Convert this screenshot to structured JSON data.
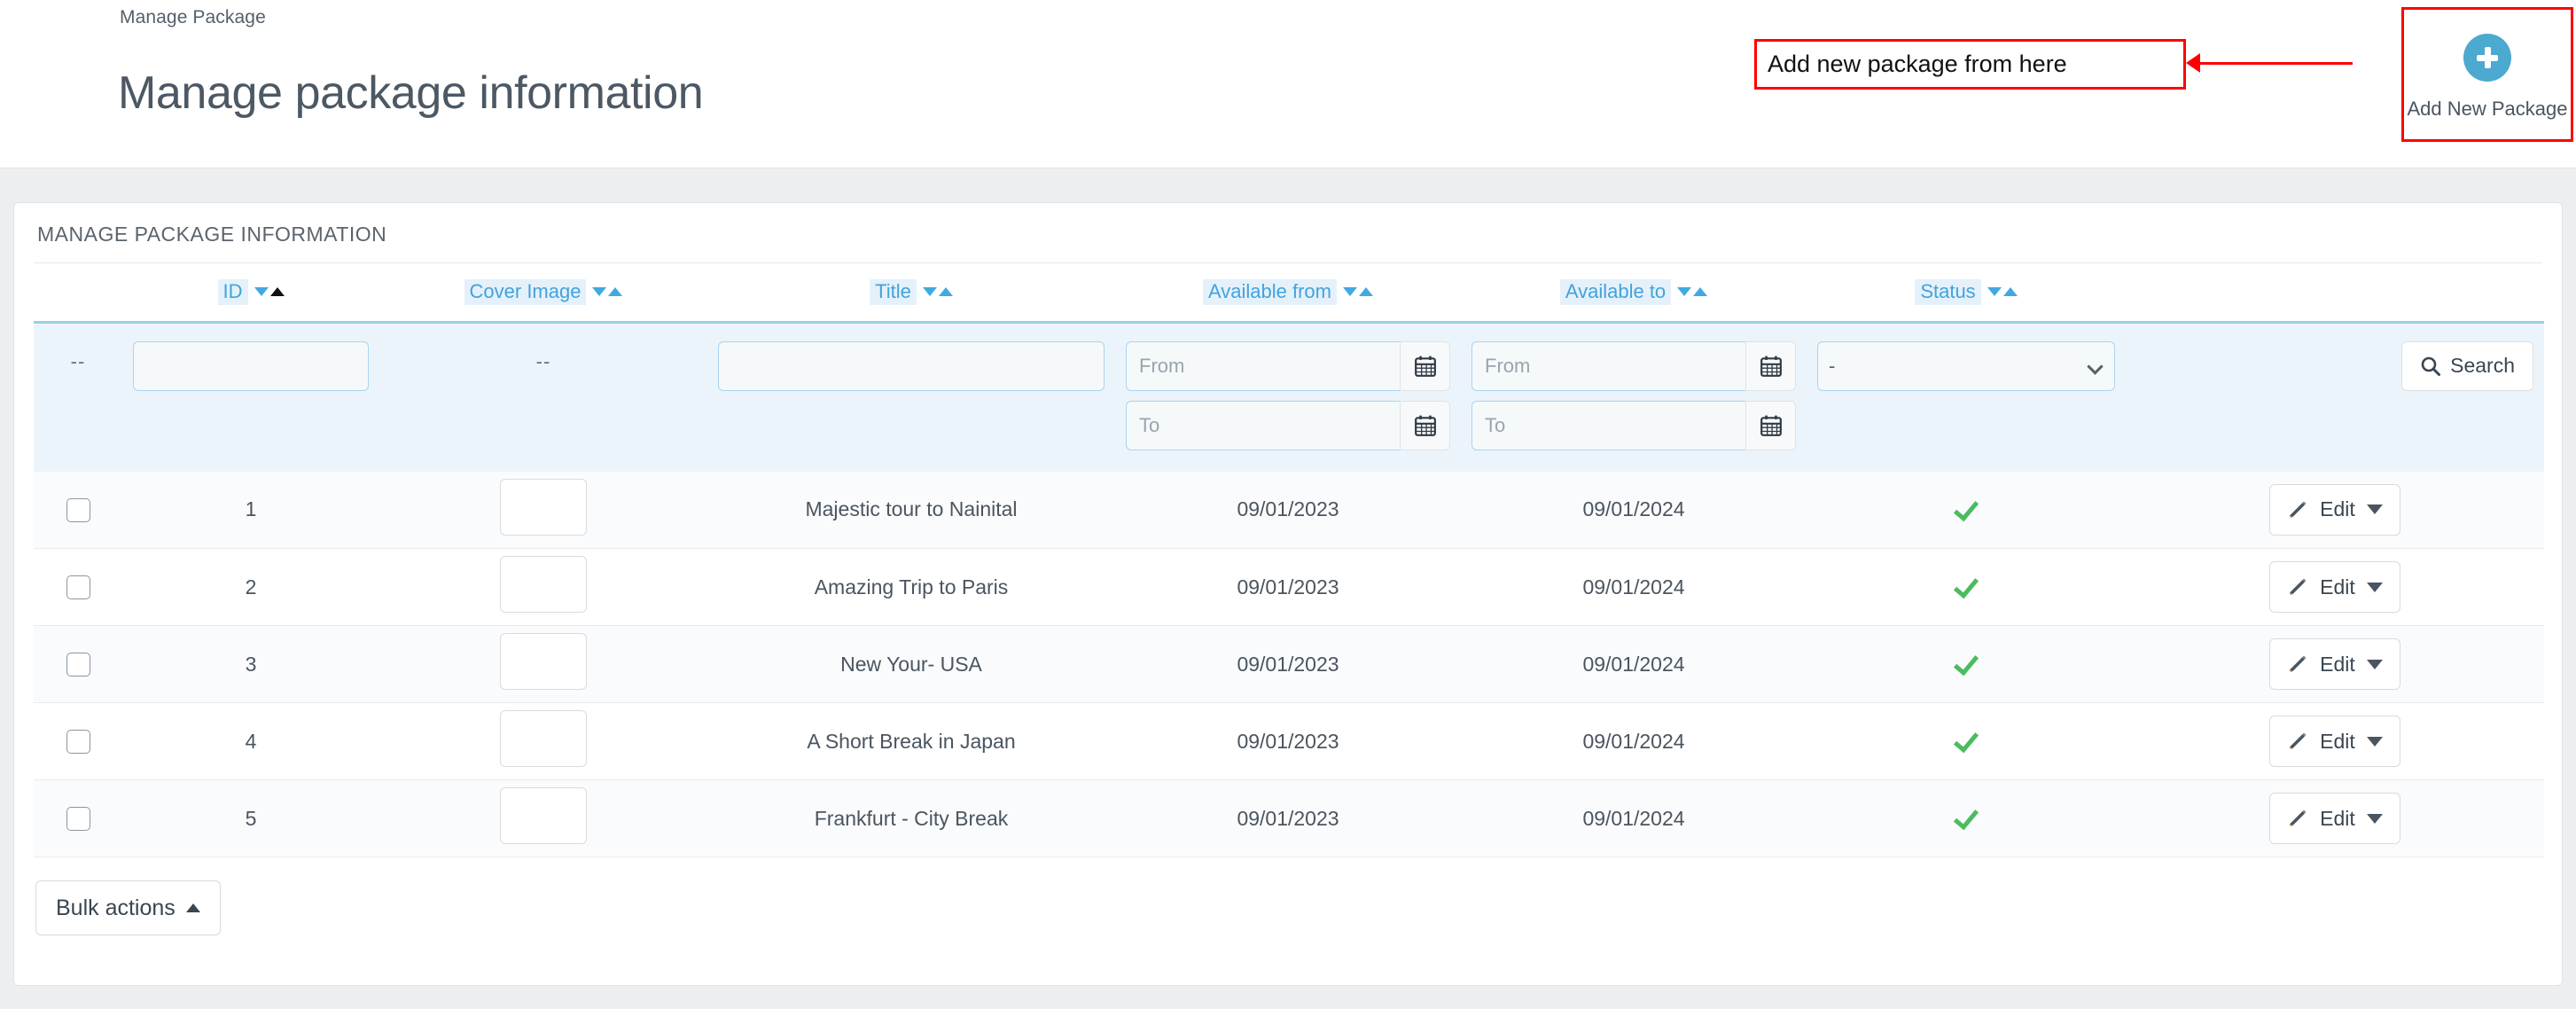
{
  "header": {
    "breadcrumb": "Manage Package",
    "title": "Manage package information",
    "annotation": "Add new package from here",
    "add_button_label": "Add New Package",
    "add_icon": "plus-circle-icon",
    "accent_blue": "#4CA9CF",
    "annotation_color": "#ff0000"
  },
  "card": {
    "title": "MANAGE PACKAGE INFORMATION"
  },
  "table": {
    "columns": [
      {
        "key": "checkbox",
        "label": "",
        "sortable": false
      },
      {
        "key": "id",
        "label": "ID",
        "sortable": true,
        "sort_active": "asc"
      },
      {
        "key": "cover_image",
        "label": "Cover Image",
        "sortable": true,
        "sort_active": "none"
      },
      {
        "key": "title",
        "label": "Title",
        "sortable": true,
        "sort_active": "none"
      },
      {
        "key": "available_from",
        "label": "Available from",
        "sortable": true,
        "sort_active": "none"
      },
      {
        "key": "available_to",
        "label": "Available to",
        "sortable": true,
        "sort_active": "none"
      },
      {
        "key": "status",
        "label": "Status",
        "sortable": true,
        "sort_active": "none"
      },
      {
        "key": "actions",
        "label": "",
        "sortable": false
      }
    ],
    "filters": {
      "checkbox_placeholder": "--",
      "id_value": "",
      "cover_image_placeholder": "--",
      "title_value": "",
      "available_from": {
        "from_placeholder": "From",
        "to_placeholder": "To",
        "from_value": "",
        "to_value": ""
      },
      "available_to": {
        "from_placeholder": "From",
        "to_placeholder": "To",
        "from_value": "",
        "to_value": ""
      },
      "status_selected": "-",
      "status_options": [
        "-"
      ],
      "search_label": "Search",
      "search_icon": "magnifier-icon",
      "calendar_icon": "calendar-icon"
    },
    "rows": [
      {
        "id": "1",
        "thumb": "forest-walk-photo",
        "title": "Majestic tour to Nainital",
        "available_from": "09/01/2023",
        "available_to": "09/01/2024",
        "status": "active",
        "action_label": "Edit"
      },
      {
        "id": "2",
        "thumb": "eiffel-tower-photo",
        "title": "Amazing Trip to Paris",
        "available_from": "09/01/2023",
        "available_to": "09/01/2024",
        "status": "active",
        "action_label": "Edit"
      },
      {
        "id": "3",
        "thumb": "city-skyline-photo",
        "title": "New Your- USA",
        "available_from": "09/01/2023",
        "available_to": "09/01/2024",
        "status": "active",
        "action_label": "Edit"
      },
      {
        "id": "4",
        "thumb": "lake-reflection-photo",
        "title": "A Short Break in Japan",
        "available_from": "09/01/2023",
        "available_to": "09/01/2024",
        "status": "active",
        "action_label": "Edit"
      },
      {
        "id": "5",
        "thumb": "canal-sunset-photo",
        "title": "Frankfurt - City Break",
        "available_from": "09/01/2023",
        "available_to": "09/01/2024",
        "status": "active",
        "action_label": "Edit"
      }
    ],
    "status_active_color": "#4cbb60"
  },
  "footer": {
    "bulk_actions_label": "Bulk actions",
    "bulk_caret": "caret-up-icon"
  }
}
